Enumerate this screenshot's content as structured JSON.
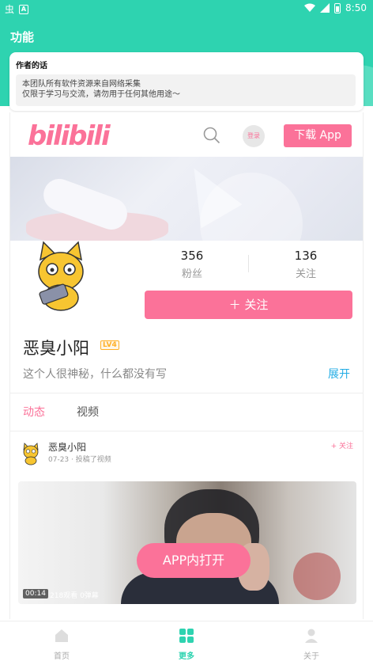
{
  "status_bar": {
    "time": "8:50"
  },
  "app_bar": {
    "title": "功能"
  },
  "author_card": {
    "heading": "作者的话",
    "lines": [
      "本团队所有软件资源来自网络采集",
      "仅限于学习与交流，请勿用于任何其他用途～"
    ]
  },
  "web": {
    "logo_text": "bilibili",
    "login_label": "登录",
    "download_label": "下载 App",
    "stats": [
      {
        "value": "356",
        "label": "粉丝"
      },
      {
        "value": "136",
        "label": "关注"
      }
    ],
    "follow_label": "＋ 关注",
    "username": "恶臭小阳",
    "level": "LV4",
    "bio": "这个人很神秘，什么都没有写",
    "expand_label": "展开",
    "tabs": [
      "动态",
      "视频"
    ],
    "post": {
      "author": "恶臭小阳",
      "meta": "07-23 · 投稿了视频",
      "follow": "+ 关注"
    },
    "video": {
      "open_label": "APP内打开",
      "duration": "00:14",
      "views": "218观看",
      "danmaku": "0弹幕"
    }
  },
  "bottom_nav": [
    {
      "label": "首页",
      "icon": "home-icon"
    },
    {
      "label": "更多",
      "icon": "grid-icon"
    },
    {
      "label": "关于",
      "icon": "person-icon"
    }
  ],
  "colors": {
    "accent": "#2ed3b0",
    "pink": "#fb7299",
    "link": "#23ade5"
  }
}
